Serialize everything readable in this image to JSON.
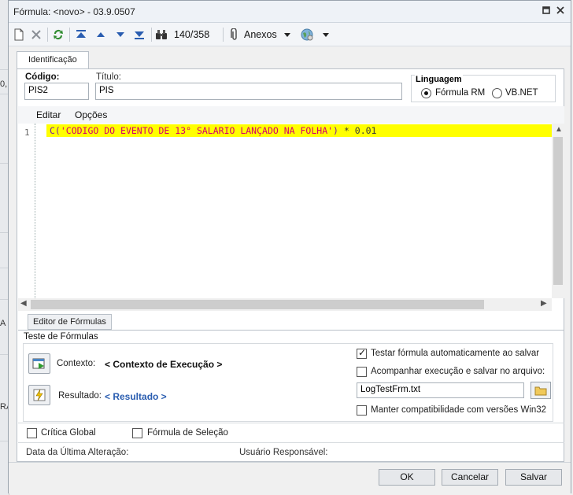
{
  "window": {
    "title": "Fórmula: <novo> - 03.9.0507"
  },
  "background_app": {
    "fragments": [
      "0,",
      "A",
      "RA"
    ]
  },
  "toolbar": {
    "counter": "140/358",
    "attachments_label": "Anexos"
  },
  "tabs": [
    {
      "label": "Identificação"
    }
  ],
  "form": {
    "codigo_label": "Código:",
    "codigo_value": "PIS2",
    "titulo_label": "Título:",
    "titulo_value": "PIS",
    "linguagem": {
      "title": "Linguagem",
      "options": [
        "Fórmula RM",
        "VB.NET"
      ],
      "selected": "Fórmula RM"
    }
  },
  "editor": {
    "menu": [
      "Editar",
      "Opções"
    ],
    "line_number": "1",
    "code": {
      "fn": "C(",
      "str": "'CODIGO DO EVENTO DE 13° SALARIO LANÇADO NA FOLHA'",
      "close": ")",
      "op": " * ",
      "num": "0.01"
    },
    "bottom_tab": "Editor de Fórmulas"
  },
  "teste": {
    "title": "Teste de Fórmulas",
    "contexto_label": "Contexto:",
    "contexto_value": "< Contexto de Execução >",
    "resultado_label": "Resultado:",
    "resultado_value": "< Resultado >",
    "check_auto": {
      "label": "Testar fórmula automaticamente ao salvar",
      "checked": true
    },
    "check_log": {
      "label": "Acompanhar execução e salvar no arquivo:",
      "checked": false
    },
    "log_file": "LogTestFrm.txt",
    "check_compat": {
      "label": "Manter compatibilidade com versões Win32",
      "checked": false
    }
  },
  "flags": {
    "critica_global": {
      "label": "Crítica Global",
      "checked": false
    },
    "formula_selecao": {
      "label": "Fórmula de Seleção",
      "checked": false
    }
  },
  "status": {
    "data_label": "Data da Última Alteração:",
    "usuario_label": "Usuário Responsável:"
  },
  "footer": {
    "ok": "OK",
    "cancel": "Cancelar",
    "save": "Salvar"
  },
  "colors": {
    "highlight": "#ffff00",
    "string": "#d4006a",
    "function": "#7a1fa2",
    "link": "#2a5db0"
  }
}
